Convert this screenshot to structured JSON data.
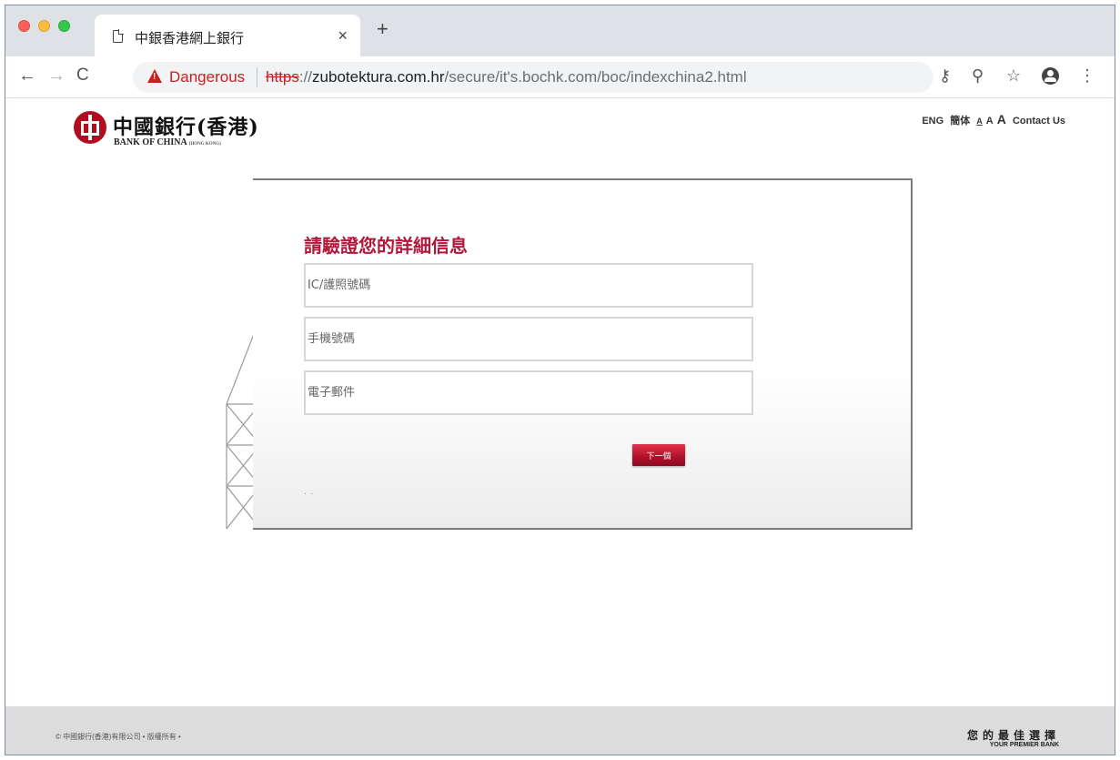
{
  "browser": {
    "tab_title": "中銀香港網上銀行",
    "tab_close": "×",
    "new_tab": "+",
    "security_label": "Dangerous",
    "url_scheme": "https",
    "url_scheme_suffix": "://",
    "url_host": "zubotektura.com.hr",
    "url_path": "/secure/it's.bochk.com/boc/indexchina2.html",
    "icons": [
      "back-icon",
      "forward-icon",
      "reload-icon",
      "warning-icon",
      "key-icon",
      "zoom-icon",
      "star-icon",
      "account-icon",
      "menu-icon"
    ]
  },
  "header": {
    "logo_cn": "中國銀行(香港)",
    "logo_en": "BANK OF CHINA",
    "logo_en_small": "(HONG KONG)",
    "lang_eng": "ENG",
    "lang_simplified": "簡体",
    "font_small": "A",
    "font_medium": "A",
    "font_large": "A",
    "contact": "Contact Us"
  },
  "form": {
    "title": "請驗證您的詳細信息",
    "fields": [
      {
        "placeholder": "IC/護照號碼"
      },
      {
        "placeholder": "手機號碼"
      },
      {
        "placeholder": "電子郵件"
      }
    ],
    "next_button": "下一個",
    "dots": ". ."
  },
  "footer": {
    "copyright": "© 中國銀行(香港)有限公司 • 版權所有 •",
    "slogan_cn": "您的最佳選擇",
    "slogan_en": "YOUR PREMIER BANK"
  },
  "colors": {
    "brand_red": "#a40f22",
    "title_red": "#b3183a",
    "danger_red": "#c5221f",
    "footer_grey": "#dcdcdc"
  }
}
